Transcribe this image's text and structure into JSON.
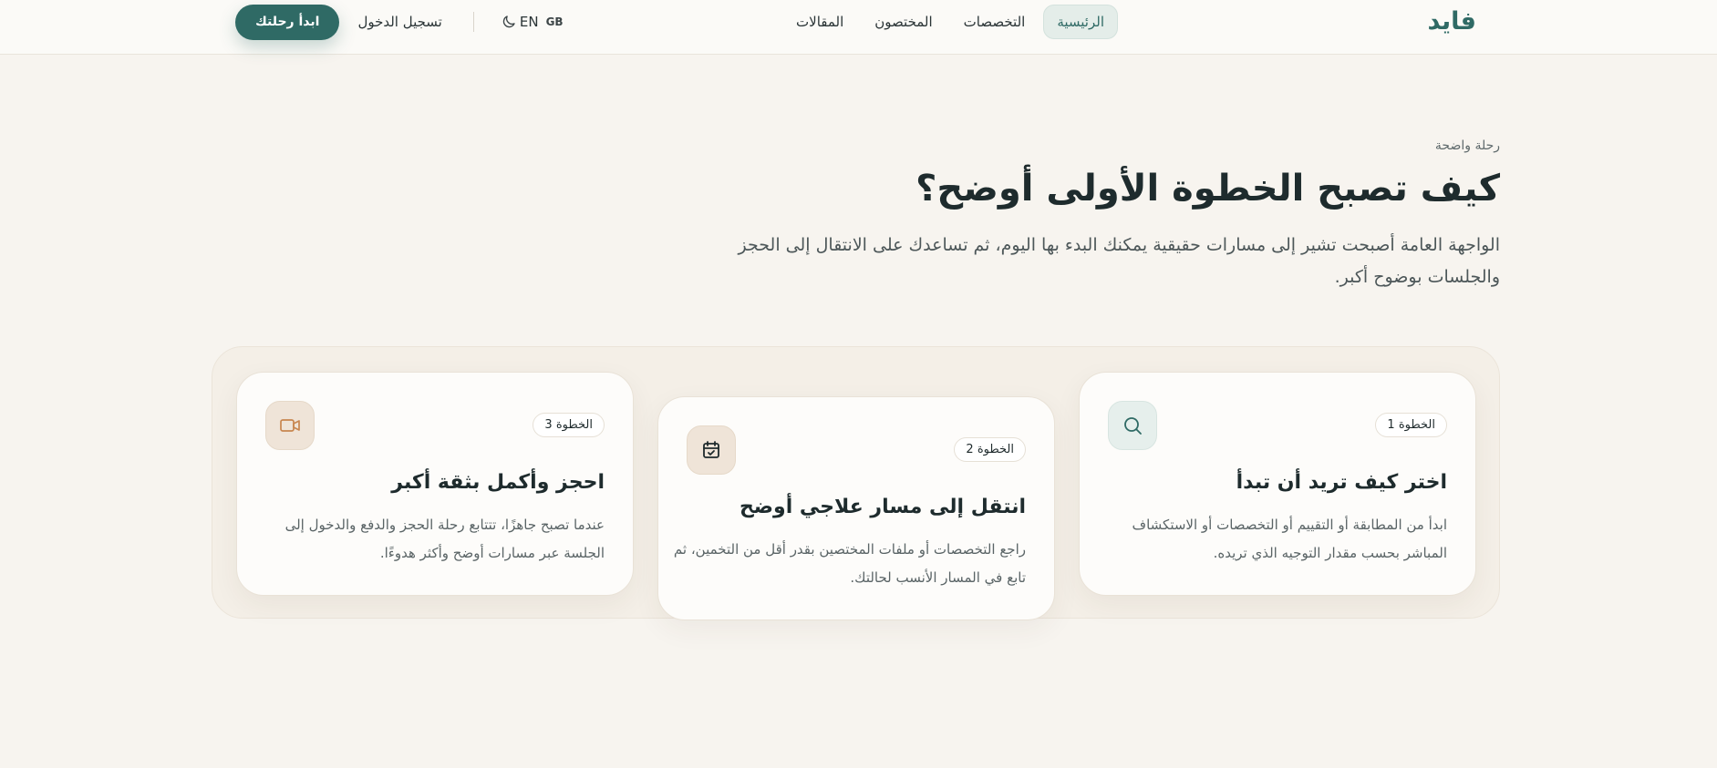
{
  "nav": {
    "brand": "فايد",
    "links": [
      "الرئيسية",
      "التخصصات",
      "المختصون",
      "المقالات"
    ],
    "active_link": "الرئيسية",
    "language": {
      "flag": "GB",
      "code": "EN"
    },
    "theme_icon": "moon-icon",
    "login_label": "تسجيل الدخول",
    "cta_label": "ابدأ رحلتك"
  },
  "hero": {
    "eyebrow": "رحلة واضحة",
    "title": "كيف تصبح الخطوة الأولى أوضح؟",
    "description": "الواجهة العامة أصبحت تشير إلى مسارات حقيقية يمكنك البدء بها اليوم، ثم تساعدك على الانتقال إلى الحجز والجلسات بوضوح أكبر."
  },
  "steps": [
    {
      "badge": "الخطوة 1",
      "icon": "search-icon",
      "title": "اختر كيف تريد أن تبدأ",
      "description": "ابدأ من المطابقة أو التقييم أو التخصصات أو الاستكشاف المباشر بحسب مقدار التوجيه الذي تريده."
    },
    {
      "badge": "الخطوة 2",
      "icon": "calendar-check-icon",
      "title": "انتقل إلى مسار علاجي أوضح",
      "description": "راجع التخصصات أو ملفات المختصين بقدر أقل من التخمين، ثم تابع في المسار الأنسب لحالتك."
    },
    {
      "badge": "الخطوة 3",
      "icon": "video-icon",
      "title": "احجز وأكمل بثقة أكبر",
      "description": "عندما تصبح جاهزًا، تتتابع رحلة الحجز والدفع والدخول إلى الجلسة عبر مسارات أوضح وأكثر هدوءًا."
    }
  ],
  "colors": {
    "brand": "#2f6a65",
    "page_bg": "#f7f4ef",
    "accent_sand": "#c8864f"
  }
}
